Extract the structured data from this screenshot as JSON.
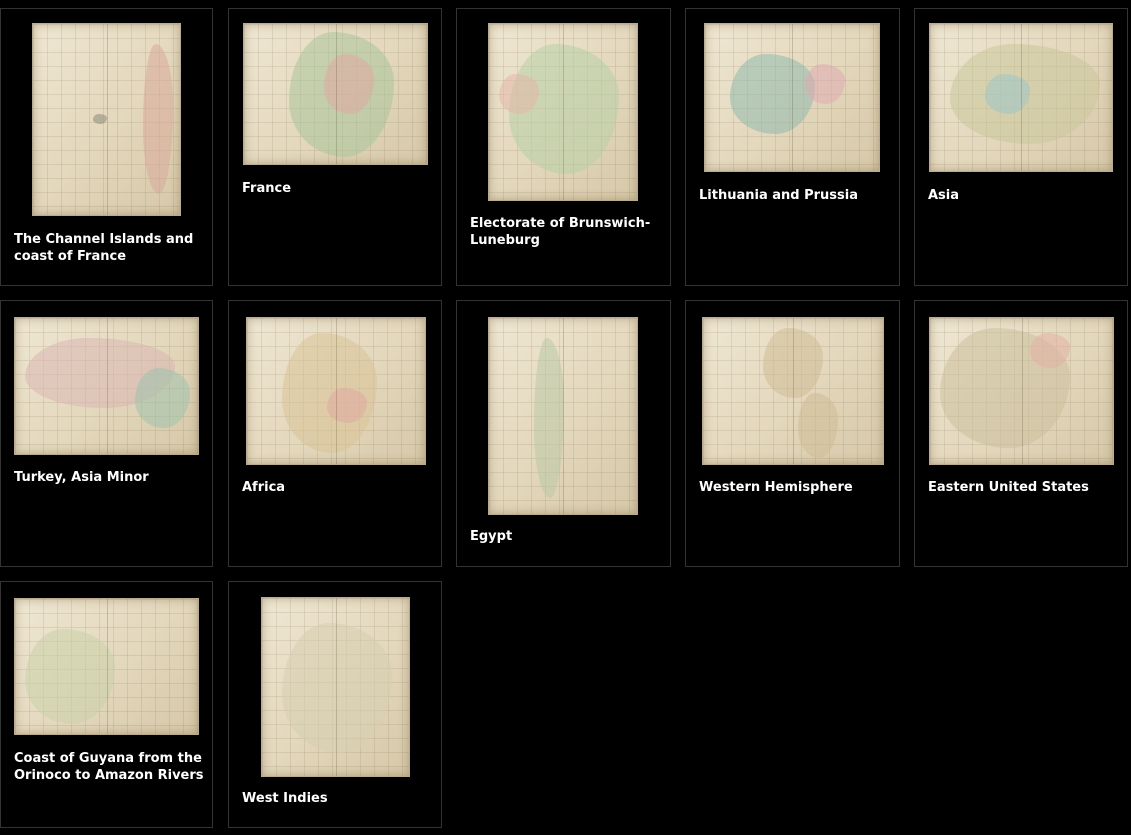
{
  "gallery": {
    "items": [
      {
        "label": "The Channel Islands and coast of France"
      },
      {
        "label": "France"
      },
      {
        "label": "Electorate of Brunswich-Luneburg"
      },
      {
        "label": "Lithuania and Prussia"
      },
      {
        "label": "Asia"
      },
      {
        "label": "Turkey, Asia Minor"
      },
      {
        "label": "Africa"
      },
      {
        "label": "Egypt"
      },
      {
        "label": "Western Hemisphere"
      },
      {
        "label": "Eastern United States"
      },
      {
        "label": "Coast of Guyana from the Orinoco to Amazon Rivers"
      },
      {
        "label": "West Indies"
      }
    ]
  },
  "colors": {
    "background": "#000000",
    "card_border": "#333333",
    "label_text": "#ffffff",
    "parchment": "#e8dfc9"
  }
}
